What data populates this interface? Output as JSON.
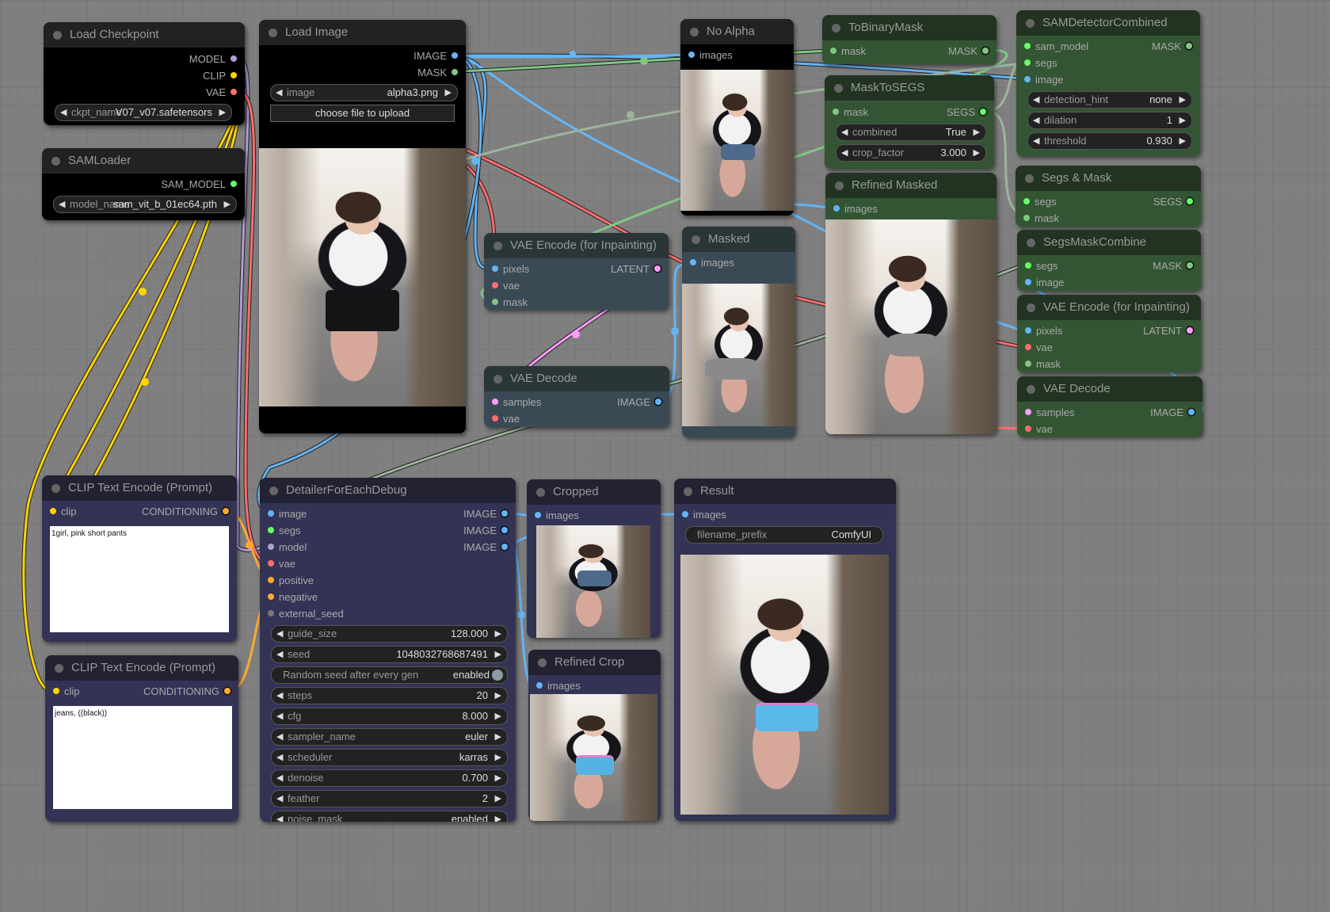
{
  "app": "ComfyUI node graph",
  "colors": {
    "canvas": "#808080",
    "slot_model": "#b39ddb",
    "slot_clip": "#ffd500",
    "slot_vae": "#ff6e6e",
    "slot_image": "#64b5f6",
    "slot_mask": "#81c784",
    "slot_segs": "#66ff66",
    "slot_latent": "#ff9cf9",
    "slot_conditioning": "#ffa931",
    "slot_sam_model": "#66ff66",
    "slot_seed": "#777777",
    "node_green": "#335533",
    "node_blue": "#333355",
    "node_black": "#000000",
    "node_slate": "#3a4a54"
  },
  "nodes": {
    "load_checkpoint": {
      "title": "Load Checkpoint",
      "outputs": [
        "MODEL",
        "CLIP",
        "VAE"
      ],
      "widgets": [
        {
          "label": "ckpt_name",
          "value": "V07_v07.safetensors"
        }
      ]
    },
    "sam_loader": {
      "title": "SAMLoader",
      "outputs": [
        "SAM_MODEL"
      ],
      "widgets": [
        {
          "label": "model_name",
          "value": "sam_vit_b_01ec64.pth"
        }
      ]
    },
    "load_image": {
      "title": "Load Image",
      "outputs": [
        "IMAGE",
        "MASK"
      ],
      "widgets": [
        {
          "label": "image",
          "value": "alpha3.png"
        }
      ],
      "upload_button": "choose file to upload"
    },
    "no_alpha": {
      "title": "No Alpha",
      "inputs": [
        "images"
      ]
    },
    "to_binary_mask": {
      "title": "ToBinaryMask",
      "inputs": [
        "mask"
      ],
      "outputs": [
        "MASK"
      ]
    },
    "mask_to_segs": {
      "title": "MaskToSEGS",
      "inputs": [
        "mask"
      ],
      "outputs": [
        "SEGS"
      ],
      "widgets": [
        {
          "label": "combined",
          "value": "True"
        },
        {
          "label": "crop_factor",
          "value": "3.000"
        }
      ]
    },
    "sam_detector_combined": {
      "title": "SAMDetectorCombined",
      "inputs": [
        "sam_model",
        "segs",
        "image"
      ],
      "outputs": [
        "MASK"
      ],
      "widgets": [
        {
          "label": "detection_hint",
          "value": "none"
        },
        {
          "label": "dilation",
          "value": "1"
        },
        {
          "label": "threshold",
          "value": "0.930"
        }
      ]
    },
    "segs_and_mask": {
      "title": "Segs & Mask",
      "inputs": [
        "segs",
        "mask"
      ],
      "outputs": [
        "SEGS"
      ]
    },
    "segs_mask_combine": {
      "title": "SegsMaskCombine",
      "inputs": [
        "segs",
        "image"
      ],
      "outputs": [
        "MASK"
      ]
    },
    "vae_encode_inpaint_right": {
      "title": "VAE Encode (for Inpainting)",
      "inputs": [
        "pixels",
        "vae",
        "mask"
      ],
      "outputs": [
        "LATENT"
      ]
    },
    "vae_decode_right": {
      "title": "VAE Decode",
      "inputs": [
        "samples",
        "vae"
      ],
      "outputs": [
        "IMAGE"
      ]
    },
    "refined_masked": {
      "title": "Refined Masked",
      "inputs": [
        "images"
      ]
    },
    "vae_encode_inpaint_mid": {
      "title": "VAE Encode (for Inpainting)",
      "inputs": [
        "pixels",
        "vae",
        "mask"
      ],
      "outputs": [
        "LATENT"
      ]
    },
    "vae_decode_mid": {
      "title": "VAE Decode",
      "inputs": [
        "samples",
        "vae"
      ],
      "outputs": [
        "IMAGE"
      ]
    },
    "masked": {
      "title": "Masked",
      "inputs": [
        "images"
      ]
    },
    "clip_text_positive": {
      "title": "CLIP Text Encode (Prompt)",
      "inputs": [
        "clip"
      ],
      "outputs": [
        "CONDITIONING"
      ],
      "text": "1girl, pink short pants"
    },
    "clip_text_negative": {
      "title": "CLIP Text Encode (Prompt)",
      "inputs": [
        "clip"
      ],
      "outputs": [
        "CONDITIONING"
      ],
      "text": "jeans, ((black))"
    },
    "detailer": {
      "title": "DetailerForEachDebug",
      "inputs": [
        "image",
        "segs",
        "model",
        "vae",
        "positive",
        "negative",
        "external_seed"
      ],
      "outputs": [
        "IMAGE",
        "IMAGE",
        "IMAGE"
      ],
      "widgets": [
        {
          "label": "guide_size",
          "value": "128.000"
        },
        {
          "label": "seed",
          "value": "1048032768687491"
        },
        {
          "label": "Random seed after every gen",
          "value": "enabled",
          "type": "toggle"
        },
        {
          "label": "steps",
          "value": "20"
        },
        {
          "label": "cfg",
          "value": "8.000"
        },
        {
          "label": "sampler_name",
          "value": "euler"
        },
        {
          "label": "scheduler",
          "value": "karras"
        },
        {
          "label": "denoise",
          "value": "0.700"
        },
        {
          "label": "feather",
          "value": "2"
        },
        {
          "label": "noise_mask",
          "value": "enabled"
        }
      ]
    },
    "cropped": {
      "title": "Cropped",
      "inputs": [
        "images"
      ]
    },
    "refined_crop": {
      "title": "Refined Crop",
      "inputs": [
        "images"
      ]
    },
    "result": {
      "title": "Result",
      "inputs": [
        "images"
      ],
      "widgets": [
        {
          "label": "filename_prefix",
          "value": "ComfyUI"
        }
      ]
    }
  }
}
